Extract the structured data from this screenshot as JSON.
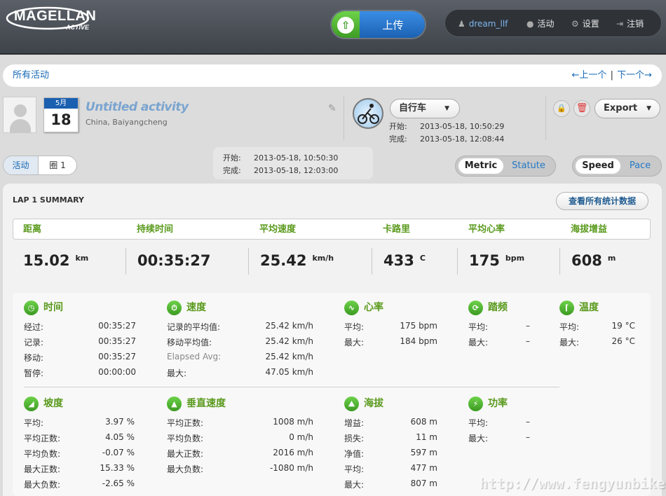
{
  "header": {
    "logo_text": "MAGELLAN",
    "logo_sub": "ACTIVE",
    "upload_label": "上传",
    "nav": {
      "user": "dream_llf",
      "activity": "活动",
      "settings": "设置",
      "logout": "注销"
    }
  },
  "breadcrumb": {
    "title": "所有活动",
    "prev": "←上一个",
    "separator": "|",
    "next": "下一个→"
  },
  "activity": {
    "month": "5月",
    "day": "18",
    "title": "Untitled activity",
    "location": "China, Baiyangcheng",
    "sport": "自行车",
    "start_label": "开始:",
    "start": "2013-05-18, 10:50:29",
    "finish_label": "完成:",
    "finish": "2013-05-18, 12:08:44",
    "export_label": "Export"
  },
  "tabs": {
    "activity": "活动",
    "lap": "圈 1"
  },
  "lap_time": {
    "start_label": "开始:",
    "start": "2013-05-18, 10:50:30",
    "finish_label": "完成:",
    "finish": "2013-05-18, 12:03:00"
  },
  "units_toggle": {
    "on": "Metric",
    "off": "Statute"
  },
  "speed_toggle": {
    "on": "Speed",
    "off": "Pace"
  },
  "summary": {
    "title": "LAP 1 SUMMARY",
    "all_stats_button": "查看所有统计数据",
    "items": [
      {
        "label": "距离",
        "value": "15.02",
        "unit": "km"
      },
      {
        "label": "持续时间",
        "value": "00:35:27",
        "unit": ""
      },
      {
        "label": "平均速度",
        "value": "25.42",
        "unit": "km/h"
      },
      {
        "label": "卡路里",
        "value": "433",
        "unit": "C"
      },
      {
        "label": "平均心率",
        "value": "175",
        "unit": "bpm"
      },
      {
        "label": "海拔增益",
        "value": "608",
        "unit": "m"
      }
    ]
  },
  "sections": {
    "time": {
      "title": "时间",
      "rows": [
        {
          "label": "经过:",
          "value": "00:35:27"
        },
        {
          "label": "记录:",
          "value": "00:35:27"
        },
        {
          "label": "移动:",
          "value": "00:35:27"
        },
        {
          "label": "暂停:",
          "value": "00:00:00"
        }
      ]
    },
    "speed": {
      "title": "速度",
      "rows": [
        {
          "label": "记录的平均值:",
          "value": "25.42 km/h"
        },
        {
          "label": "移动平均值:",
          "value": "25.42 km/h"
        },
        {
          "label": "Elapsed Avg:",
          "value": "25.42 km/h"
        },
        {
          "label": "最大:",
          "value": "47.05 km/h"
        }
      ]
    },
    "heart": {
      "title": "心率",
      "rows": [
        {
          "label": "平均:",
          "value": "175 bpm"
        },
        {
          "label": "最大:",
          "value": "184 bpm"
        }
      ]
    },
    "cadence": {
      "title": "踏频",
      "rows": [
        {
          "label": "平均:",
          "value": "–"
        },
        {
          "label": "最大:",
          "value": "–"
        }
      ]
    },
    "temp": {
      "title": "温度",
      "rows": [
        {
          "label": "平均:",
          "value": "19 °C"
        },
        {
          "label": "最大:",
          "value": "26 °C"
        }
      ]
    },
    "grade": {
      "title": "坡度",
      "rows": [
        {
          "label": "平均:",
          "value": "3.97 %"
        },
        {
          "label": "平均正数:",
          "value": "4.05 %"
        },
        {
          "label": "平均负数:",
          "value": "-0.07 %"
        },
        {
          "label": "最大正数:",
          "value": "15.33 %"
        },
        {
          "label": "最大负数:",
          "value": "-2.65 %"
        }
      ]
    },
    "vspeed": {
      "title": "垂直速度",
      "rows": [
        {
          "label": "平均正数:",
          "value": "1008 m/h"
        },
        {
          "label": "平均负数:",
          "value": "0 m/h"
        },
        {
          "label": "最大正数:",
          "value": "2016 m/h"
        },
        {
          "label": "最大负数:",
          "value": "-1080 m/h"
        }
      ]
    },
    "elev": {
      "title": "海拔",
      "rows": [
        {
          "label": "增益:",
          "value": "608 m"
        },
        {
          "label": "损失:",
          "value": "11 m"
        },
        {
          "label": "净值:",
          "value": "597 m"
        },
        {
          "label": "平均:",
          "value": "477 m"
        },
        {
          "label": "最大:",
          "value": "807 m"
        }
      ]
    },
    "power": {
      "title": "功率",
      "rows": [
        {
          "label": "平均:",
          "value": "–"
        },
        {
          "label": "最大:",
          "value": "–"
        }
      ]
    }
  },
  "watermark": "http://www.fengyunbike.com",
  "colors": {
    "accent_green": "#5a9a1d",
    "link_blue": "#1769b5",
    "header_dark": "#3e434a"
  }
}
